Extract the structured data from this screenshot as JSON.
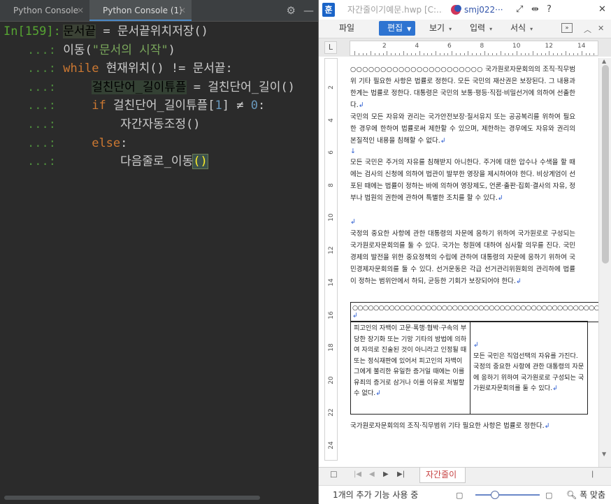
{
  "left_pane": {
    "tabs": [
      {
        "label": "Python Console",
        "active": false
      },
      {
        "label": "Python Console (1)",
        "active": true
      }
    ],
    "tool_icons": [
      "gear-icon",
      "minimize-icon"
    ],
    "lines": [
      {
        "prompt": "In[159]:",
        "parts": [
          {
            "t": "문서끝",
            "c": "hl"
          },
          {
            "t": " = 문서끝위치저장()",
            "c": "tx"
          }
        ]
      },
      {
        "prompt": "...:",
        "parts": [
          {
            "t": "이동(",
            "c": "tx"
          },
          {
            "t": "\"문서의 시작\"",
            "c": "st"
          },
          {
            "t": ")",
            "c": "tx"
          }
        ]
      },
      {
        "prompt": "...:",
        "parts": [
          {
            "t": "while",
            "c": "kw"
          },
          {
            "t": " 현재위치() != 문서끝:",
            "c": "tx"
          }
        ]
      },
      {
        "prompt": "...:",
        "parts": [
          {
            "t": "    ",
            "c": "tx"
          },
          {
            "t": "걸친단어_길이튜플",
            "c": "hl2"
          },
          {
            "t": " = 걸친단어_길이()",
            "c": "tx"
          }
        ]
      },
      {
        "prompt": "...:",
        "parts": [
          {
            "t": "    ",
            "c": "tx"
          },
          {
            "t": "if",
            "c": "kw"
          },
          {
            "t": " 걸친단어_길이튜플[",
            "c": "tx"
          },
          {
            "t": "1",
            "c": "nm"
          },
          {
            "t": "] ≠ ",
            "c": "tx"
          },
          {
            "t": "0",
            "c": "nm"
          },
          {
            "t": ":",
            "c": "tx"
          }
        ]
      },
      {
        "prompt": "...:",
        "parts": [
          {
            "t": "        자간자동조정()",
            "c": "tx"
          }
        ]
      },
      {
        "prompt": "...:",
        "parts": [
          {
            "t": "    ",
            "c": "tx"
          },
          {
            "t": "else",
            "c": "kw"
          },
          {
            "t": ":",
            "c": "tx"
          }
        ]
      },
      {
        "prompt": "...:",
        "parts": [
          {
            "t": "        다음줄로_이동",
            "c": "tx"
          },
          {
            "t": "()",
            "c": "caret-paren"
          }
        ]
      }
    ]
  },
  "right_pane": {
    "window": {
      "logo": "훈",
      "title": "자간줄이기예문.hwp [C:...",
      "user": "smj022···",
      "buttons": [
        "⤢",
        "⇹",
        "?",
        "✕"
      ]
    },
    "menu": {
      "items": [
        {
          "label": "파일",
          "has_arrow": false
        },
        {
          "label": "편집",
          "has_arrow": true,
          "active": true
        },
        {
          "label": "보기",
          "has_arrow": true
        },
        {
          "label": "입력",
          "has_arrow": true
        },
        {
          "label": "서식",
          "has_arrow": true
        }
      ],
      "more": "»"
    },
    "ruler": {
      "corner": "L",
      "numbers": [
        "2",
        "4",
        "6",
        "8",
        "10",
        "12",
        "14"
      ],
      "vertical_numbers": [
        "2",
        "4",
        "6",
        "8",
        "10",
        "12",
        "14",
        "16",
        "18",
        "20",
        "22",
        "24"
      ]
    },
    "doc": {
      "p1": "○○○○○○○○○○○○○○○○○○○○○○ 국가원로자문회의의 조직·직무범위 기타 필요한 사항은 법률로 정한다. 모든 국민의 재산권은 보장된다. 그 내용과 한계는 법률로 정한다. 대통령은 국민의 보통·평등·직접·비밀선거에 의하여 선출한다.",
      "p2": " 국민의 모든 자유와 권리는 국가안전보장·질서유지 또는 공공복리를 위하여 필요한 경우에 한하여 법률로써 제한할 수 있으며, 제한하는 경우에도 자유와 권리의 본질적인 내용을 침해할 수 없다.",
      "p3": " 모든 국민은 주거의 자유를 침해받지 아니한다. 주거에 대한 압수나 수색을 할 때에는 검사의 신청에 의하여 법관이 발부한 영장을 제시하여야 한다. 비상계엄이 선포된 때에는 법률이 정하는 바에 의하여 영장제도, 언론·출판·집회·결사의 자유, 정부나 법원의 권한에 관하여 특별한 조치를 할 수 있다.",
      "p4": "국정의 중요한 사항에 관한 대통령의 자문에 응하기 위하여 국가원로로 구성되는 국가원로자문회의를 둘 수 있다. 국가는 청원에 대하여 심사할 의무를 진다. 국민경제의 발전을 위한 중요정책의 수립에 관하여 대통령의 자문에 응하기 위하여 국민경제자문회의를 둘 수 있다. 선거운동은 각급 선거관리위원회의 관리하에 법률이 정하는 범위안에서 하되, 균등한 기회가 보장되어야 한다.",
      "table_top": "○○○○○○○○○○○○○○○○○○○○○○○○○○○○○○○○○○○○○○○○○○○○○○○○○○○○",
      "table_left": "피고인의 자백이 고문·폭행·협박·구속의 부당한 장기화 또는 기망 기타의 방법에 의하여 자의로 진술된 것이 아니라고 인정될 때 또는 정식재판에 있어서 피고인의 자백이 그에게 불리한 유일한 증거일 때에는 이를 유죄의 증거로 삼거나 이를 이유로 처벌할 수 없다.",
      "table_right": "모든 국민은 직업선택의 자유를 가진다. 국정의 중요한 사항에 관한 대통령의 자문에 응하기 위하여 국가원로로 구성되는 국가원로자문회의를 둘 수 있다.",
      "p5": "국가원로자문회의의 조직·직무범위    기타 필요한 사항은 법률로 정한다."
    },
    "sheet_tab": "자간줄이",
    "status": {
      "text": "1개의 추가 기능 사용 중",
      "zoom": "폭 맞춤"
    }
  }
}
